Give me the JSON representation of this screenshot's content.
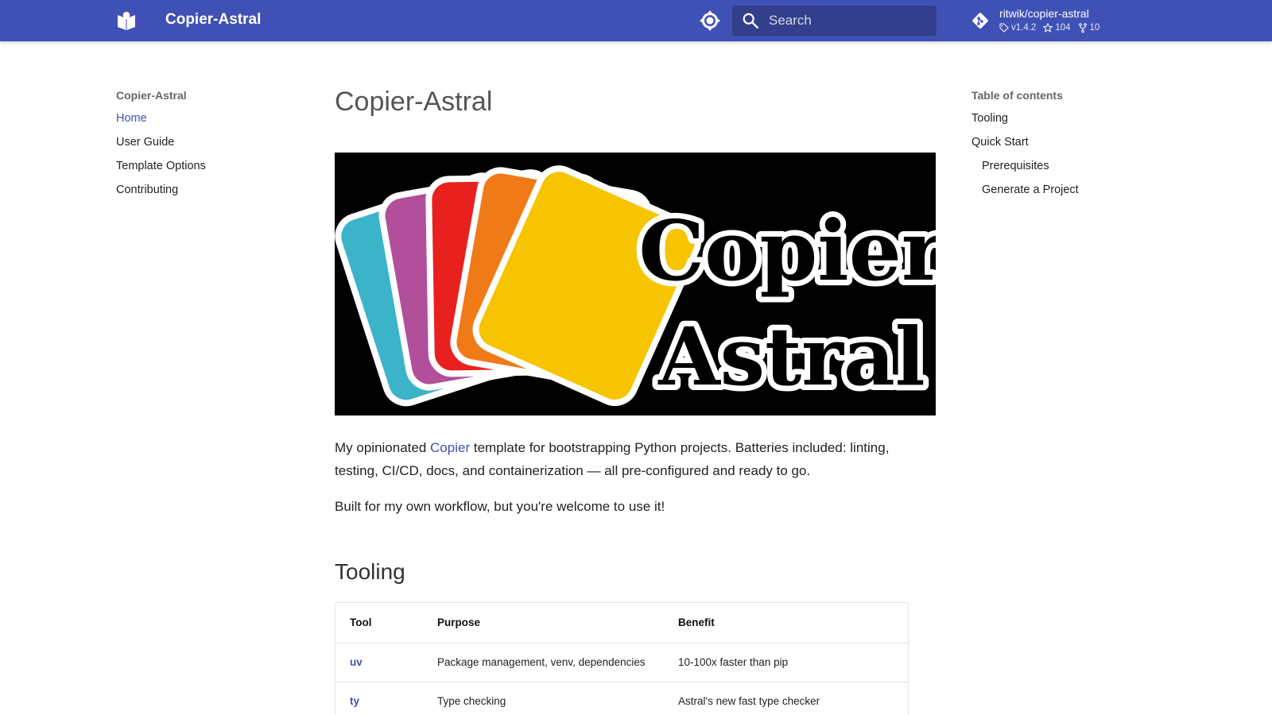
{
  "header": {
    "site_title": "Copier-Astral",
    "search_placeholder": "Search",
    "repo": {
      "name": "ritwik/copier-astral",
      "version": "v1.4.2",
      "stars": "104",
      "forks": "10"
    }
  },
  "nav": {
    "title": "Copier-Astral",
    "items": [
      {
        "label": "Home"
      },
      {
        "label": "User Guide"
      },
      {
        "label": "Template Options"
      },
      {
        "label": "Contributing"
      }
    ]
  },
  "toc": {
    "title": "Table of contents",
    "items": [
      {
        "label": "Tooling"
      },
      {
        "label": "Quick Start"
      },
      {
        "label": "Prerequisites"
      },
      {
        "label": "Generate a Project"
      }
    ]
  },
  "content": {
    "title": "Copier-Astral",
    "hero": {
      "line1": "Copier",
      "line2": "Astral"
    },
    "intro_before": "My opinionated ",
    "intro_link": "Copier",
    "intro_after": " template for bootstrapping Python projects. Batteries included: linting, testing, CI/CD, docs, and containerization — all pre-configured and ready to go.",
    "note": "Built for my own workflow, but you're welcome to use it!",
    "tooling_heading": "Tooling",
    "table": {
      "headers": [
        "Tool",
        "Purpose",
        "Benefit"
      ],
      "rows": [
        [
          "uv",
          "Package management, venv, dependencies",
          "10-100x faster than pip"
        ],
        [
          "ty",
          "Type checking",
          "Astral's new fast type checker"
        ]
      ]
    }
  },
  "colors": {
    "primary": "#4051b5",
    "card_teal": "#3bb3c9",
    "card_magenta": "#b14f9b",
    "card_red": "#e8211f",
    "card_orange": "#f07a16",
    "card_yellow": "#f6c400"
  }
}
